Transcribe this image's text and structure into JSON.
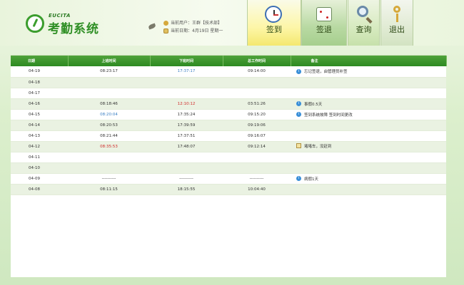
{
  "app": {
    "brand": "EUCITA",
    "title": "考勤系统"
  },
  "user_info": {
    "current_user": "当前用户：王群【技术部】",
    "current_date": "当前日期：4月19日 星期一"
  },
  "toolbar": {
    "checkin_label": "签到",
    "checkout_label": "签退",
    "query_label": "查询",
    "exit_label": "退出"
  },
  "table": {
    "headers": [
      "日期",
      "上班时间",
      "下班时间",
      "总工作时间",
      "备注"
    ],
    "rows": [
      {
        "date": "04-19",
        "in": "08:23:17",
        "out": "17:37:17",
        "total": "09:14:00",
        "note": "忘记签退，由管理员补签",
        "note_icon": "info-icon",
        "out_color": "blue"
      },
      {
        "date": "04-18",
        "in": "",
        "out": "",
        "total": "",
        "note": "",
        "note_icon": ""
      },
      {
        "date": "04-17",
        "in": "",
        "out": "",
        "total": "",
        "note": "",
        "note_icon": ""
      },
      {
        "date": "04-16",
        "in": "08:18:46",
        "out": "12:10:12",
        "total": "03:51:26",
        "note": "事假0.5天",
        "note_icon": "info-icon",
        "out_color": "red"
      },
      {
        "date": "04-15",
        "in": "08:20:04",
        "out": "17:35:24",
        "total": "09:15:20",
        "note": "签到系统故障 签到时间更改",
        "note_icon": "info-icon",
        "in_color": "blue"
      },
      {
        "date": "04-14",
        "in": "08:20:53",
        "out": "17:39:59",
        "total": "09:19:06",
        "note": "",
        "note_icon": ""
      },
      {
        "date": "04-13",
        "in": "08:21:44",
        "out": "17:37:51",
        "total": "09:16:07",
        "note": "",
        "note_icon": ""
      },
      {
        "date": "04-12",
        "in": "08:35:53",
        "out": "17:48:07",
        "total": "09:12:14",
        "note": "堵堵车，没赶到",
        "note_icon": "edit-icon",
        "in_color": "red"
      },
      {
        "date": "04-11",
        "in": "",
        "out": "",
        "total": "",
        "note": "",
        "note_icon": ""
      },
      {
        "date": "04-10",
        "in": "",
        "out": "",
        "total": "",
        "note": "",
        "note_icon": ""
      },
      {
        "date": "04-09",
        "in": "----------",
        "out": "----------",
        "total": "----------",
        "note": "病假1天",
        "note_icon": "info-icon"
      },
      {
        "date": "04-08",
        "in": "08:11:15",
        "out": "18:15:55",
        "total": "10:04:40",
        "note": "",
        "note_icon": ""
      }
    ]
  },
  "colors": {
    "header_green": "#2d8a22",
    "late_red": "#d02a2a",
    "modified_blue": "#3a7fc4"
  }
}
